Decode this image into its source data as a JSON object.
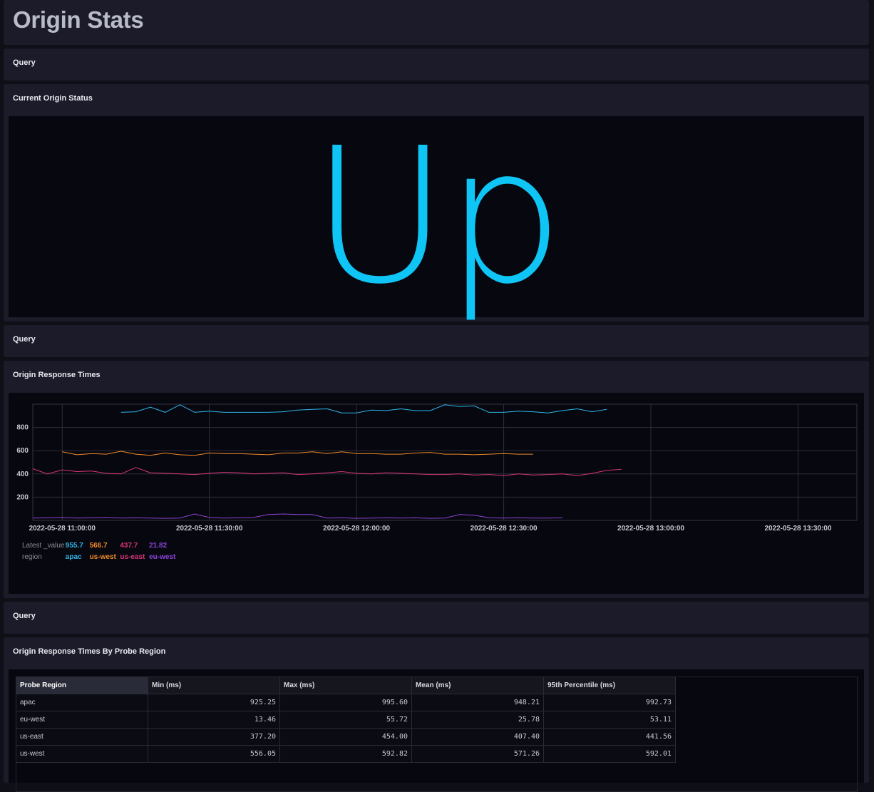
{
  "page": {
    "title": "Origin Stats"
  },
  "sections": {
    "query_1": "Query",
    "status_title": "Current Origin Status",
    "status_value": "Up",
    "query_2": "Query",
    "response_title": "Origin Response Times",
    "query_3": "Query",
    "table_title": "Origin Response Times By Probe Region"
  },
  "colors": {
    "apac": "#2fb6e8",
    "us-west": "#f08a2a",
    "us-east": "#d8367a",
    "eu-west": "#8e44d6",
    "status": "#0ec5f5"
  },
  "legend": {
    "value_label": "Latest _value",
    "group_label": "region",
    "values": [
      "955.7",
      "566.7",
      "437.7",
      "21.82"
    ],
    "regions": [
      "apac",
      "us-west",
      "us-east",
      "eu-west"
    ]
  },
  "chart_data": {
    "type": "line",
    "x": [
      "10:54",
      "10:57",
      "11:00",
      "11:03",
      "11:06",
      "11:09",
      "11:12",
      "11:15",
      "11:18",
      "11:21",
      "11:24",
      "11:27",
      "11:30",
      "11:33",
      "11:36",
      "11:39",
      "11:42",
      "11:45",
      "11:48",
      "11:51",
      "11:54",
      "11:57",
      "12:00",
      "12:03",
      "12:06",
      "12:09",
      "12:12",
      "12:15",
      "12:18",
      "12:21",
      "12:24",
      "12:27",
      "12:30",
      "12:33",
      "12:36",
      "12:39",
      "12:42",
      "12:45",
      "12:48",
      "12:51",
      "12:54",
      "12:57",
      "13:00",
      "13:03",
      "13:06",
      "13:09",
      "13:12",
      "13:15",
      "13:18",
      "13:21",
      "13:24",
      "13:27",
      "13:30",
      "13:33",
      "13:36",
      "13:39",
      "13:42"
    ],
    "x_tick_labels": [
      "2022-05-28 11:00:00",
      "2022-05-28 11:30:00",
      "2022-05-28 12:00:00",
      "2022-05-28 12:30:00",
      "2022-05-28 13:00:00",
      "2022-05-28 13:30:00"
    ],
    "y_ticks": [
      200,
      400,
      600,
      800
    ],
    "ylim": [
      0,
      1000
    ],
    "grid": true,
    "legend_position": "bottom-left",
    "series": [
      {
        "name": "apac",
        "values": [
          null,
          null,
          null,
          null,
          null,
          null,
          930,
          935,
          975,
          930,
          995,
          930,
          940,
          930,
          930,
          930,
          930,
          935,
          950,
          955,
          960,
          925,
          925,
          950,
          945,
          960,
          945,
          945,
          995,
          980,
          985,
          930,
          930,
          940,
          935,
          925,
          945,
          960,
          935,
          955,
          null,
          null,
          null,
          null,
          null,
          null,
          null,
          null,
          null,
          null,
          null,
          null,
          null,
          null,
          null,
          null,
          null
        ]
      },
      {
        "name": "us-west",
        "values": [
          null,
          null,
          590,
          565,
          575,
          570,
          595,
          570,
          560,
          580,
          565,
          560,
          580,
          575,
          575,
          570,
          565,
          580,
          580,
          590,
          575,
          590,
          575,
          575,
          570,
          570,
          580,
          585,
          570,
          570,
          565,
          570,
          575,
          570,
          570,
          null,
          null,
          null,
          null,
          null,
          null,
          null,
          null,
          null,
          null,
          null,
          null,
          null,
          null,
          null,
          null,
          null,
          null,
          null,
          null,
          null,
          null
        ]
      },
      {
        "name": "us-east",
        "values": [
          445,
          400,
          435,
          420,
          425,
          405,
          400,
          455,
          410,
          405,
          400,
          395,
          405,
          415,
          410,
          400,
          405,
          410,
          395,
          400,
          410,
          420,
          405,
          400,
          410,
          405,
          400,
          395,
          395,
          400,
          390,
          395,
          385,
          400,
          390,
          395,
          400,
          385,
          405,
          430,
          440,
          null,
          null,
          null,
          null,
          null,
          null,
          null,
          null,
          null,
          null,
          null,
          null,
          null,
          null,
          null,
          null
        ]
      },
      {
        "name": "eu-west",
        "values": [
          20,
          22,
          25,
          20,
          22,
          25,
          20,
          22,
          20,
          18,
          20,
          55,
          25,
          20,
          22,
          25,
          50,
          55,
          50,
          50,
          20,
          22,
          18,
          20,
          22,
          20,
          22,
          18,
          20,
          50,
          45,
          22,
          20,
          22,
          20,
          20,
          22,
          null,
          null,
          null,
          null,
          null,
          null,
          null,
          null,
          null,
          null,
          null,
          null,
          null,
          null,
          null,
          null,
          null,
          null,
          null,
          null
        ]
      }
    ]
  },
  "table": {
    "headers": [
      "Probe Region",
      "Min (ms)",
      "Max (ms)",
      "Mean (ms)",
      "95th Percentile (ms)"
    ],
    "rows": [
      [
        "apac",
        "925.25",
        "995.60",
        "948.21",
        "992.73"
      ],
      [
        "eu-west",
        "13.46",
        "55.72",
        "25.78",
        "53.11"
      ],
      [
        "us-east",
        "377.20",
        "454.00",
        "407.40",
        "441.56"
      ],
      [
        "us-west",
        "556.05",
        "592.82",
        "571.26",
        "592.01"
      ]
    ]
  }
}
